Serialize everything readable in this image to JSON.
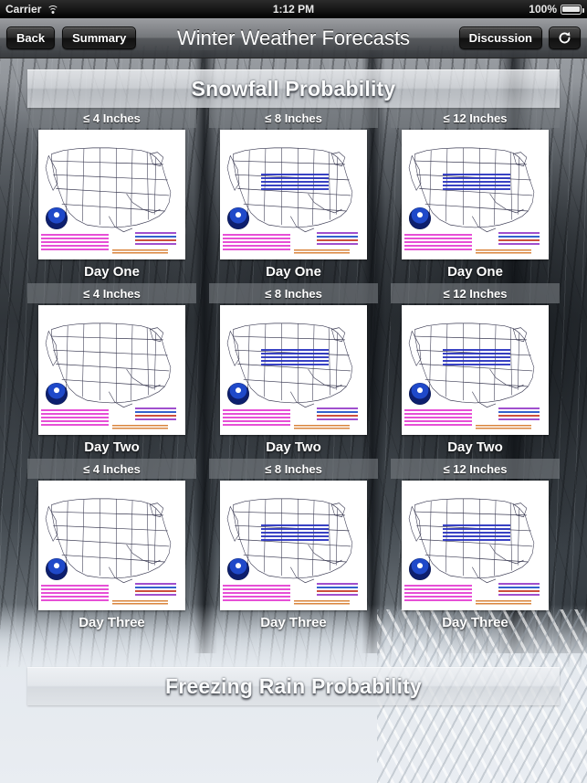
{
  "status_bar": {
    "carrier": "Carrier",
    "wifi_icon": "wifi-icon",
    "time": "1:12 PM",
    "battery_percent": "100%",
    "battery_icon": "battery-full-icon"
  },
  "nav_bar": {
    "back_label": "Back",
    "summary_label": "Summary",
    "title": "Winter Weather Forecasts",
    "discussion_label": "Discussion",
    "refresh_icon": "refresh-icon"
  },
  "sections": [
    {
      "id": "snowfall",
      "title": "Snowfall Probability"
    },
    {
      "id": "freezing_rain",
      "title": "Freezing Rain Probability"
    }
  ],
  "grid": {
    "columns": [
      "≤ 4 Inches",
      "≤ 8 Inches",
      "≤ 12 Inches"
    ],
    "rows": [
      "Day One",
      "Day Two",
      "Day Three"
    ],
    "cells": [
      {
        "threshold": "≤ 4 Inches",
        "day": "Day One",
        "map": "us-snowfall-probability-map"
      },
      {
        "threshold": "≤ 8 Inches",
        "day": "Day One",
        "map": "us-snowfall-probability-map"
      },
      {
        "threshold": "≤ 12 Inches",
        "day": "Day One",
        "map": "us-snowfall-probability-map"
      },
      {
        "threshold": "≤ 4 Inches",
        "day": "Day Two",
        "map": "us-snowfall-probability-map"
      },
      {
        "threshold": "≤ 8 Inches",
        "day": "Day Two",
        "map": "us-snowfall-probability-map"
      },
      {
        "threshold": "≤ 12 Inches",
        "day": "Day Two",
        "map": "us-snowfall-probability-map"
      },
      {
        "threshold": "≤ 4 Inches",
        "day": "Day Three",
        "map": "us-snowfall-probability-map"
      },
      {
        "threshold": "≤ 8 Inches",
        "day": "Day Three",
        "map": "us-snowfall-probability-map"
      },
      {
        "threshold": "≤ 12 Inches",
        "day": "Day Three",
        "map": "us-snowfall-probability-map"
      }
    ]
  },
  "colors": {
    "navbar_dark": "#34373b",
    "banner_light": "#e2e5e9",
    "cell_header": "#787c81",
    "map_background": "#ffffff",
    "noaa_blue": "#0d1f6e",
    "legend_magenta": "#e43cd2",
    "contour_blue": "#2832be",
    "text_white": "#ffffff"
  }
}
